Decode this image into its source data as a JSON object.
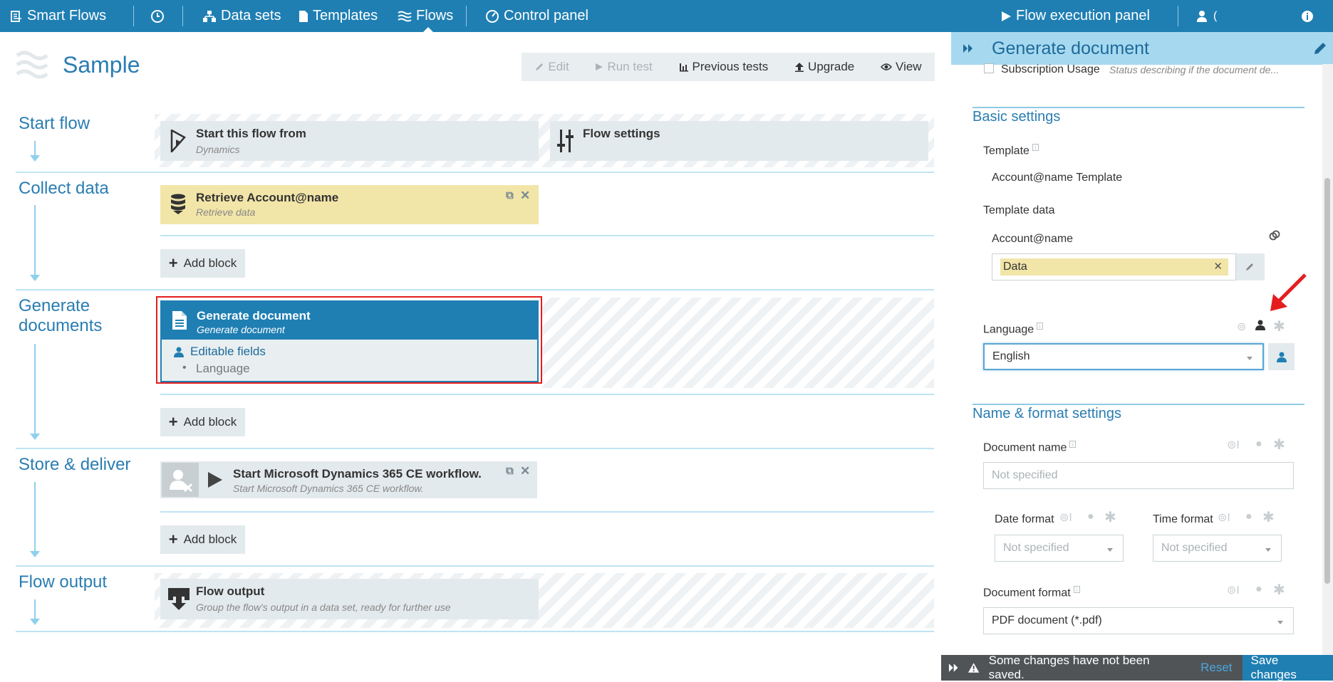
{
  "topbar": {
    "brand": "Smart Flows",
    "nav": {
      "datasets": "Data sets",
      "templates": "Templates",
      "flows": "Flows",
      "control_panel": "Control panel"
    },
    "flow_exec": "Flow execution panel",
    "user_initial": "("
  },
  "page": {
    "title": "Sample"
  },
  "actions": {
    "edit": "Edit",
    "run_test": "Run test",
    "previous_tests": "Previous tests",
    "upgrade": "Upgrade",
    "view": "View"
  },
  "sections": {
    "start": {
      "title": "Start flow",
      "block1": {
        "title": "Start this flow from",
        "subtitle": "Dynamics"
      },
      "block2": {
        "title": "Flow settings"
      }
    },
    "collect": {
      "title": "Collect data",
      "block": {
        "title": "Retrieve Account@name",
        "subtitle": "Retrieve data"
      },
      "add": "Add block"
    },
    "generate": {
      "title": "Generate documents",
      "block": {
        "title": "Generate document",
        "subtitle": "Generate document",
        "editable_label": "Editable fields",
        "field": "Language"
      },
      "add": "Add block"
    },
    "store": {
      "title": "Store & deliver",
      "block": {
        "title": "Start Microsoft Dynamics 365 CE workflow.",
        "subtitle": "Start Microsoft Dynamics 365 CE workflow."
      },
      "add": "Add block"
    },
    "output": {
      "title": "Flow output",
      "block": {
        "title": "Flow output",
        "subtitle": "Group the flow's output in a data set, ready for further use"
      }
    }
  },
  "panel": {
    "title": "Generate document",
    "subscription": {
      "label": "Subscription Usage",
      "desc": "Status describing if the document de..."
    },
    "basic": {
      "heading": "Basic settings",
      "template_label": "Template",
      "template_value": "Account@name Template",
      "template_data_label": "Template data",
      "account_label": "Account@name",
      "data_tag": "Data",
      "language_label": "Language",
      "language_value": "English"
    },
    "name_format": {
      "heading": "Name & format settings",
      "doc_name_label": "Document name",
      "doc_name_placeholder": "Not specified",
      "date_format_label": "Date format",
      "date_format_value": "Not specified",
      "time_format_label": "Time format",
      "time_format_value": "Not specified",
      "doc_format_label": "Document format",
      "doc_format_value": "PDF document (*.pdf)"
    }
  },
  "savebar": {
    "message": "Some changes have not been saved.",
    "reset": "Reset",
    "save": "Save changes"
  },
  "colors": {
    "topbar": "#1f7fb3",
    "accent": "#2a7db2",
    "highlight_yellow": "#f2e5a8",
    "selected_block": "#1f7fb3",
    "red_annotation": "#e41e1e"
  }
}
